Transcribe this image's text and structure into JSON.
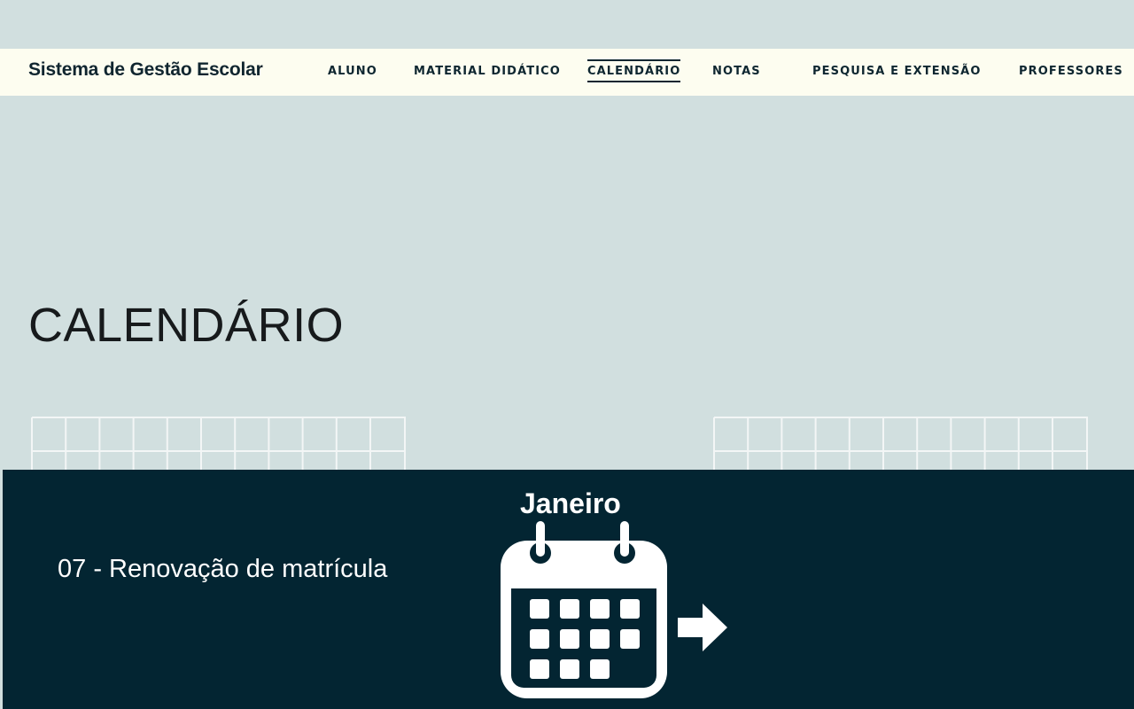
{
  "header": {
    "brand": "Sistema de Gestão Escolar",
    "nav": [
      {
        "label": "ALUNO",
        "active": false
      },
      {
        "label": "MATERIAL DIDÁTICO",
        "active": false
      },
      {
        "label": "CALENDÁRIO",
        "active": true
      },
      {
        "label": "NOTAS",
        "active": false
      },
      {
        "label": "PESQUISA E EXTENSÃO",
        "active": false
      },
      {
        "label": "PROFESSORES",
        "active": false
      }
    ]
  },
  "main": {
    "title": "CALENDÁRIO"
  },
  "event": {
    "month": "Janeiro",
    "item": "07 - Renovação de matrícula",
    "icons": [
      "calendar-icon",
      "arrow-right-icon"
    ]
  },
  "colors": {
    "page_bg": "#d1dfdf",
    "nav_bg": "#fdfdf0",
    "nav_text": "#0e2630",
    "panel_bg": "#032532",
    "panel_text": "#ffffff"
  }
}
